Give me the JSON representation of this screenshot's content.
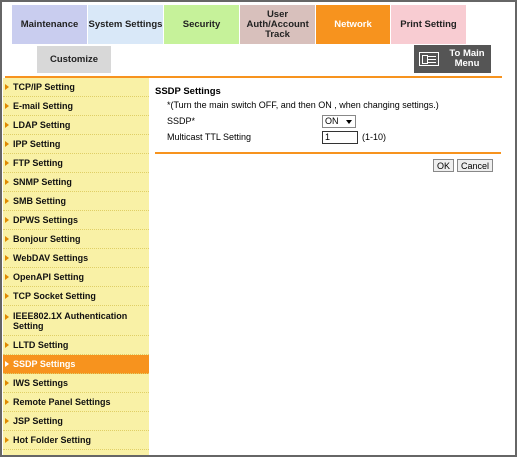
{
  "tabs": [
    {
      "label": "Maintenance"
    },
    {
      "label": "System Settings"
    },
    {
      "label": "Security"
    },
    {
      "label": "User Auth/Account Track"
    },
    {
      "label": "Network"
    },
    {
      "label": "Print Setting"
    }
  ],
  "customize_label": "Customize",
  "main_menu_label": "To Main Menu",
  "sidebar": {
    "items": [
      {
        "label": "TCP/IP Setting"
      },
      {
        "label": "E-mail Setting"
      },
      {
        "label": "LDAP Setting"
      },
      {
        "label": "IPP Setting"
      },
      {
        "label": "FTP Setting"
      },
      {
        "label": "SNMP Setting"
      },
      {
        "label": "SMB Setting"
      },
      {
        "label": "DPWS Settings"
      },
      {
        "label": "Bonjour Setting"
      },
      {
        "label": "WebDAV Settings"
      },
      {
        "label": "OpenAPI Setting"
      },
      {
        "label": "TCP Socket Setting"
      },
      {
        "label": "IEEE802.1X Authentication Setting"
      },
      {
        "label": "LLTD Setting"
      },
      {
        "label": "SSDP Settings"
      },
      {
        "label": "IWS Settings"
      },
      {
        "label": "Remote Panel Settings"
      },
      {
        "label": "JSP Setting"
      },
      {
        "label": "Hot Folder Setting"
      }
    ],
    "active": "SSDP Settings"
  },
  "content": {
    "title": "SSDP Settings",
    "note": "*(Turn the main switch OFF, and then ON , when changing settings.)",
    "ssdp_label": "SSDP*",
    "ssdp_value": "ON",
    "ttl_label": "Multicast TTL Setting",
    "ttl_value": "1",
    "ttl_range": "(1-10)"
  },
  "buttons": {
    "ok": "OK",
    "cancel": "Cancel"
  },
  "colors": {
    "accent": "#f7931e",
    "sidebar": "#f9f1a6"
  }
}
